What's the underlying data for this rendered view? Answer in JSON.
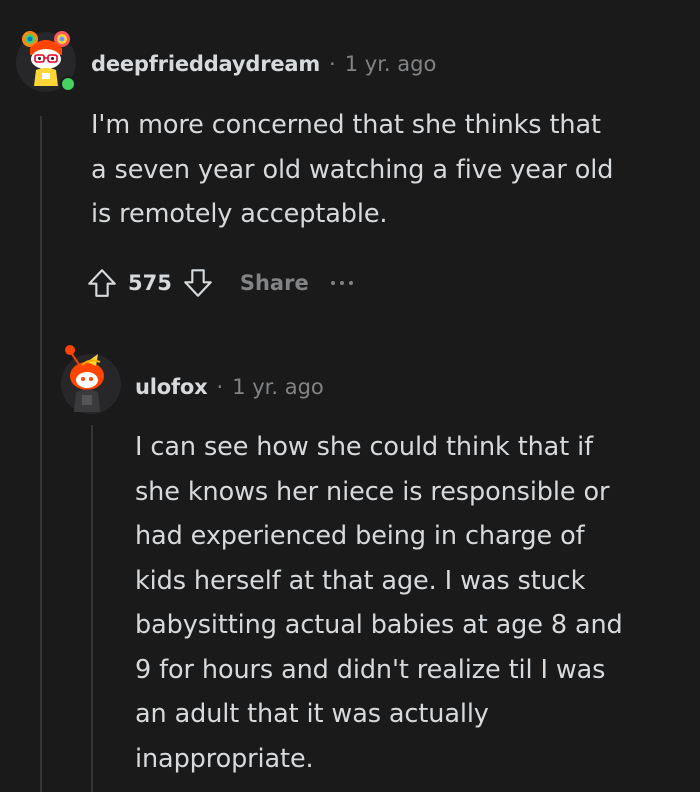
{
  "comments": [
    {
      "username": "deepfrieddaydream",
      "separator": "·",
      "time": "1 yr. ago",
      "body": "I'm more concerned that she thinks that\na seven year old watching a five year old\nis remotely acceptable.",
      "score": "575",
      "share_label": "Share",
      "online": true
    },
    {
      "username": "ulofox",
      "separator": "·",
      "time": "1 yr. ago",
      "body": "I can see how she could think that if\nshe knows her niece is responsible or\nhad experienced being in charge of\nkids herself at that age. I was stuck\nbabysitting actual babies at age 8 and\n9 for hours and didn't realize til I was\nan adult that it was actually\ninappropriate."
    }
  ],
  "colors": {
    "background": "#1a1a1b",
    "text": "#d7dadc",
    "muted": "#818384",
    "thread_line": "#343536",
    "online": "#46d160",
    "snoo_orange": "#ff4500"
  },
  "icons": {
    "upvote": "upvote-arrow-icon",
    "downvote": "downvote-arrow-icon",
    "more": "ellipsis-icon"
  }
}
